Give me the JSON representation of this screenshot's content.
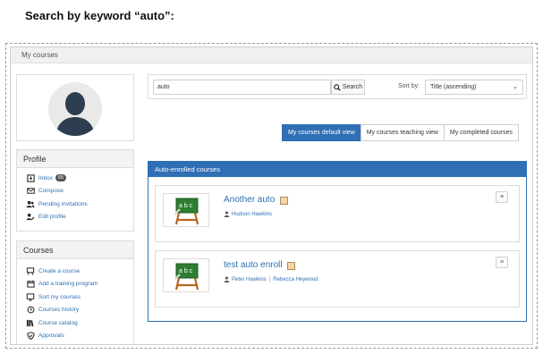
{
  "caption": "Search by keyword “auto”:",
  "breadcrumb": "My courses",
  "search": {
    "value": "auto",
    "button_label": "Search",
    "sort_label": "Sort by:",
    "sort_selected": "Title (ascending)"
  },
  "views": [
    {
      "label": "My courses default view",
      "active": true
    },
    {
      "label": "My courses teaching view",
      "active": false
    },
    {
      "label": "My completed courses",
      "active": false
    }
  ],
  "profile": {
    "title": "Profile",
    "items": [
      {
        "label": "Inbox",
        "icon": "inbox-icon",
        "badge": "65"
      },
      {
        "label": "Compose",
        "icon": "envelope-icon"
      },
      {
        "label": "Pending invitations",
        "icon": "users-icon"
      },
      {
        "label": "Edit profile",
        "icon": "user-edit-icon"
      }
    ]
  },
  "courses": {
    "title": "Courses",
    "items": [
      {
        "label": "Create a course",
        "icon": "board-icon"
      },
      {
        "label": "Add a training program",
        "icon": "calendar-icon"
      },
      {
        "label": "Sort my courses",
        "icon": "monitor-icon"
      },
      {
        "label": "Courses history",
        "icon": "history-icon"
      },
      {
        "label": "Course catalog",
        "icon": "books-icon"
      },
      {
        "label": "Approvals",
        "icon": "shield-check-icon"
      }
    ]
  },
  "enrolled": {
    "title": "Auto-enrolled courses",
    "items": [
      {
        "title": "Another auto",
        "teachers": [
          "Hudson Hawkins"
        ]
      },
      {
        "title": "test auto enroll",
        "teachers": [
          "Peter Hawkins",
          "Rebecca Heywood"
        ]
      }
    ]
  },
  "colors": {
    "accent": "#2f6fb5",
    "board": "#2e7d32",
    "easel": "#b5651d"
  }
}
